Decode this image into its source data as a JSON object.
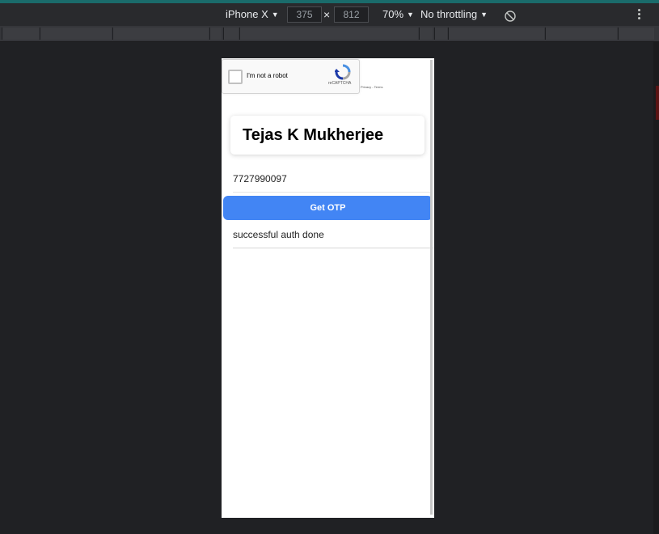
{
  "devtools": {
    "device": "iPhone X",
    "width": "375",
    "times": "×",
    "height": "812",
    "zoom": "70%",
    "throttling": "No throttling",
    "caret": "▼"
  },
  "recaptcha": {
    "label": "I'm not a robot",
    "brand": "reCAPTCHA",
    "links": "Privacy - Terms"
  },
  "app": {
    "name": "Tejas K Mukherjee",
    "phone": "7727990097",
    "otp_button": "Get OTP",
    "status": "successful auth done"
  },
  "colors": {
    "button": "#4285f4",
    "background": "#202124"
  },
  "icons": [
    "rotate-icon",
    "more-vert-icon",
    "recaptcha-logo-icon"
  ]
}
